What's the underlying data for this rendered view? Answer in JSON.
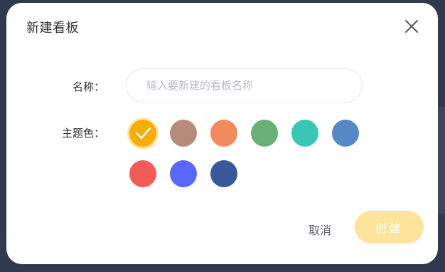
{
  "dialog": {
    "title": "新建看板",
    "close_icon": "close-icon"
  },
  "form": {
    "name_label": "名称：",
    "name_placeholder": "输入要新建的看板名称",
    "name_value": "",
    "theme_label": "主题色：",
    "selected_color_index": 0,
    "colors": [
      {
        "hex": "#f6ad0a",
        "selected": true
      },
      {
        "hex": "#b78b7b",
        "selected": false
      },
      {
        "hex": "#f18a5c",
        "selected": false
      },
      {
        "hex": "#6aaf78",
        "selected": false
      },
      {
        "hex": "#3ac6b4",
        "selected": false
      },
      {
        "hex": "#5688c6",
        "selected": false
      },
      {
        "hex": "#f45b57",
        "selected": false
      },
      {
        "hex": "#5a67fc",
        "selected": false
      },
      {
        "hex": "#385899",
        "selected": false
      }
    ]
  },
  "actions": {
    "cancel_label": "取消",
    "create_label": "创建",
    "create_bg": "#fde49a"
  }
}
